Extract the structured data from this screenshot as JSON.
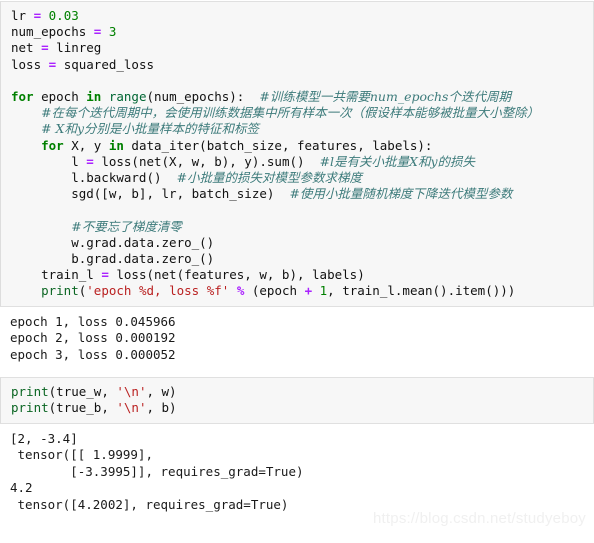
{
  "theme": {
    "cell_background": "#f7f7f7",
    "cell_border": "#e0e0e0",
    "page_background": "#ffffff",
    "keyword_color": "#008000",
    "operator_color": "#aa22ff",
    "string_color": "#ba2121",
    "comment_color": "#3d7b7b",
    "number_color": "#008000",
    "builtin_color": "#006633",
    "text_color": "#111111",
    "watermark_color": "#f0f0f0"
  },
  "cells": [
    {
      "type": "code",
      "name": "training-loop-cell",
      "lines": [
        [
          {
            "t": "lr ",
            "c": "plain"
          },
          {
            "t": "=",
            "c": "op"
          },
          {
            "t": " ",
            "c": "plain"
          },
          {
            "t": "0.03",
            "c": "num"
          }
        ],
        [
          {
            "t": "num_epochs ",
            "c": "plain"
          },
          {
            "t": "=",
            "c": "op"
          },
          {
            "t": " ",
            "c": "plain"
          },
          {
            "t": "3",
            "c": "num"
          }
        ],
        [
          {
            "t": "net ",
            "c": "plain"
          },
          {
            "t": "=",
            "c": "op"
          },
          {
            "t": " linreg",
            "c": "plain"
          }
        ],
        [
          {
            "t": "loss ",
            "c": "plain"
          },
          {
            "t": "=",
            "c": "op"
          },
          {
            "t": " squared_loss",
            "c": "plain"
          }
        ],
        [
          {
            "t": "",
            "c": "plain"
          }
        ],
        [
          {
            "t": "for",
            "c": "kw"
          },
          {
            "t": " epoch ",
            "c": "plain"
          },
          {
            "t": "in",
            "c": "kw"
          },
          {
            "t": " ",
            "c": "plain"
          },
          {
            "t": "range",
            "c": "bi"
          },
          {
            "t": "(num_epochs):  ",
            "c": "plain"
          },
          {
            "t": "#训练模型一共需要num_epochs个迭代周期",
            "c": "cm"
          }
        ],
        [
          {
            "t": "    ",
            "c": "plain"
          },
          {
            "t": "#在每个迭代周期中，会使用训练数据集中所有样本一次（假设样本能够被批量大小整除）",
            "c": "cm"
          }
        ],
        [
          {
            "t": "    ",
            "c": "plain"
          },
          {
            "t": "# X和y分别是小批量样本的特征和标签",
            "c": "cm"
          }
        ],
        [
          {
            "t": "    ",
            "c": "plain"
          },
          {
            "t": "for",
            "c": "kw"
          },
          {
            "t": " X, y ",
            "c": "plain"
          },
          {
            "t": "in",
            "c": "kw"
          },
          {
            "t": " data_iter(batch_size, features, labels):",
            "c": "plain"
          }
        ],
        [
          {
            "t": "        l ",
            "c": "plain"
          },
          {
            "t": "=",
            "c": "op"
          },
          {
            "t": " loss(net(X, w, b), y).sum()  ",
            "c": "plain"
          },
          {
            "t": "#l是有关小批量X和y的损失",
            "c": "cm"
          }
        ],
        [
          {
            "t": "        l.backward()  ",
            "c": "plain"
          },
          {
            "t": "#小批量的损失对模型参数求梯度",
            "c": "cm"
          }
        ],
        [
          {
            "t": "        sgd([w, b], lr, batch_size)  ",
            "c": "plain"
          },
          {
            "t": "#使用小批量随机梯度下降迭代模型参数",
            "c": "cm"
          }
        ],
        [
          {
            "t": "",
            "c": "plain"
          }
        ],
        [
          {
            "t": "        ",
            "c": "plain"
          },
          {
            "t": "#不要忘了梯度清零",
            "c": "cm"
          }
        ],
        [
          {
            "t": "        w.grad.data.zero_()",
            "c": "plain"
          }
        ],
        [
          {
            "t": "        b.grad.data.zero_()",
            "c": "plain"
          }
        ],
        [
          {
            "t": "    train_l ",
            "c": "plain"
          },
          {
            "t": "=",
            "c": "op"
          },
          {
            "t": " loss(net(features, w, b), labels)",
            "c": "plain"
          }
        ],
        [
          {
            "t": "    ",
            "c": "plain"
          },
          {
            "t": "print",
            "c": "fn"
          },
          {
            "t": "(",
            "c": "plain"
          },
          {
            "t": "'epoch %d, loss %f'",
            "c": "str"
          },
          {
            "t": " ",
            "c": "plain"
          },
          {
            "t": "%",
            "c": "op"
          },
          {
            "t": " (epoch ",
            "c": "plain"
          },
          {
            "t": "+",
            "c": "op"
          },
          {
            "t": " ",
            "c": "plain"
          },
          {
            "t": "1",
            "c": "num"
          },
          {
            "t": ", train_l.mean().item()))",
            "c": "plain"
          }
        ]
      ]
    },
    {
      "type": "output",
      "name": "training-loss-output",
      "text": "epoch 1, loss 0.045966\nepoch 2, loss 0.000192\nepoch 3, loss 0.000052"
    },
    {
      "type": "code",
      "name": "print-params-cell",
      "lines": [
        [
          {
            "t": "print",
            "c": "fn"
          },
          {
            "t": "(true_w, ",
            "c": "plain"
          },
          {
            "t": "'\\n'",
            "c": "str"
          },
          {
            "t": ", w)",
            "c": "plain"
          }
        ],
        [
          {
            "t": "print",
            "c": "fn"
          },
          {
            "t": "(true_b, ",
            "c": "plain"
          },
          {
            "t": "'\\n'",
            "c": "str"
          },
          {
            "t": ", b)",
            "c": "plain"
          }
        ]
      ]
    },
    {
      "type": "output",
      "name": "params-output",
      "text": "[2, -3.4]\n tensor([[ 1.9999],\n        [-3.3995]], requires_grad=True)\n4.2\n tensor([4.2002], requires_grad=True)"
    }
  ],
  "watermark": {
    "text": "https://blog.csdn.net/studyeboy"
  }
}
